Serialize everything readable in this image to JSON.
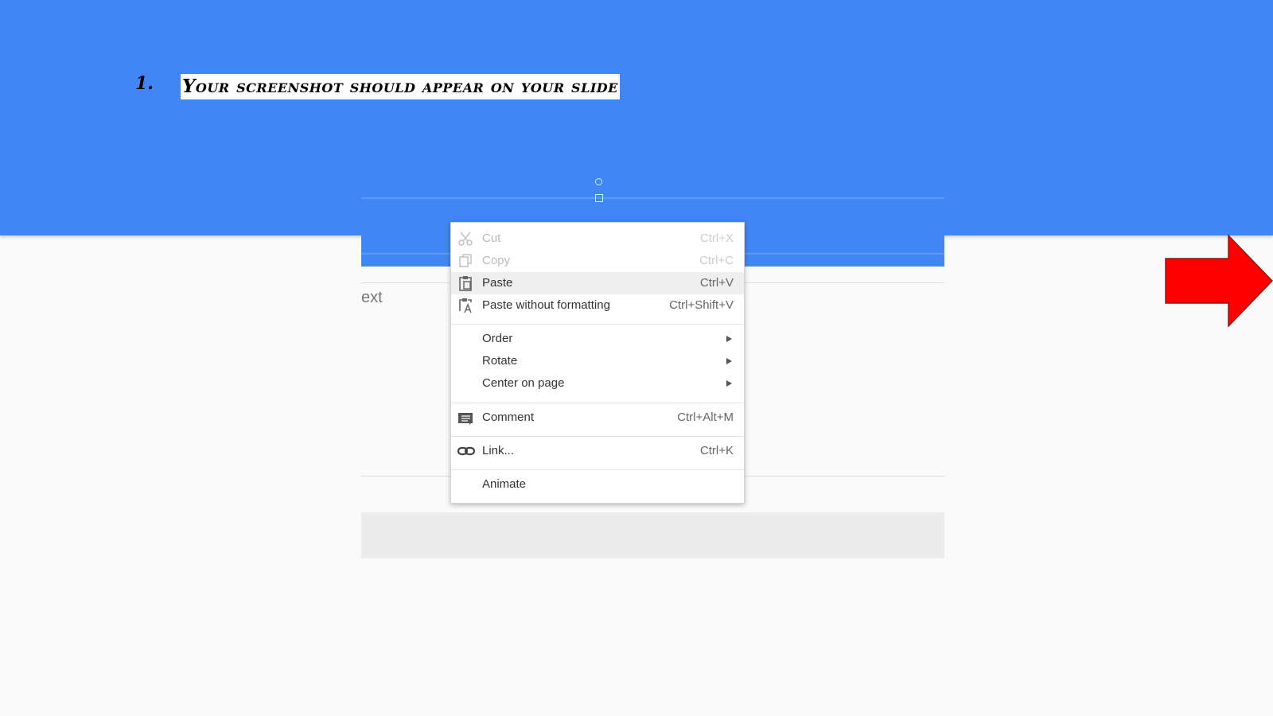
{
  "slide": {
    "step_number": "1.",
    "instruction": "Your screenshot should appear on your slide"
  },
  "screenshot": {
    "partial_text": "ext"
  },
  "context_menu": {
    "cut": {
      "label": "Cut",
      "shortcut": "Ctrl+X",
      "icon": "scissors-icon",
      "enabled": false
    },
    "copy": {
      "label": "Copy",
      "shortcut": "Ctrl+C",
      "icon": "copy-icon",
      "enabled": false
    },
    "paste": {
      "label": "Paste",
      "shortcut": "Ctrl+V",
      "icon": "clipboard-icon",
      "enabled": true,
      "highlighted": true
    },
    "paste_plain": {
      "label": "Paste without formatting",
      "shortcut": "Ctrl+Shift+V",
      "icon": "clipboard-text-icon"
    },
    "order": {
      "label": "Order",
      "submenu": true
    },
    "rotate": {
      "label": "Rotate",
      "submenu": true
    },
    "center": {
      "label": "Center on page",
      "submenu": true
    },
    "comment": {
      "label": "Comment",
      "shortcut": "Ctrl+Alt+M",
      "icon": "comment-icon"
    },
    "link": {
      "label": "Link...",
      "shortcut": "Ctrl+K",
      "icon": "link-icon"
    },
    "animate": {
      "label": "Animate"
    }
  },
  "colors": {
    "slide_band": "#4285f4",
    "arrow": "#ff0000",
    "menu_highlight": "#eeeeee"
  }
}
